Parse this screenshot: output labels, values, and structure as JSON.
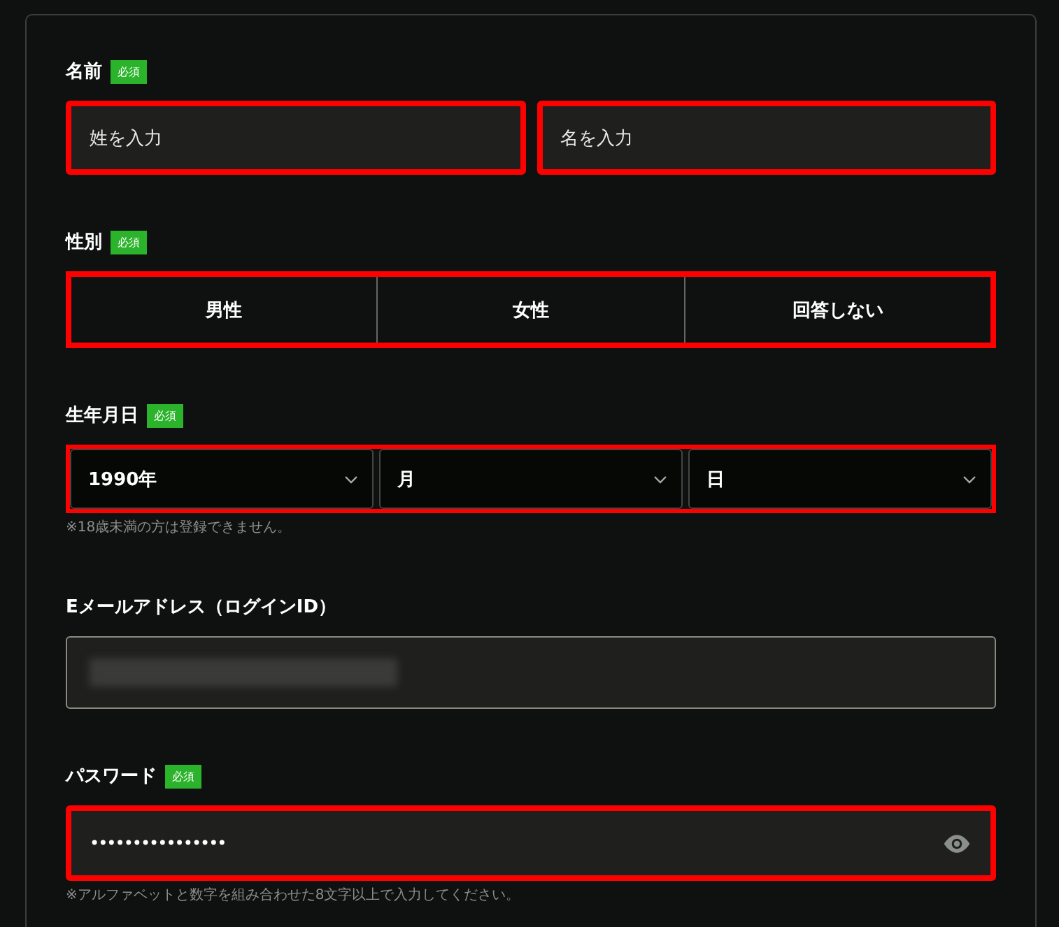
{
  "name": {
    "label": "名前",
    "badge": "必須",
    "fields": [
      {
        "placeholder": "姓を入力",
        "error": true
      },
      {
        "placeholder": "名を入力",
        "error": true
      }
    ]
  },
  "gender": {
    "label": "性別",
    "badge": "必須",
    "error": true,
    "options": [
      {
        "label": "男性",
        "selected": false
      },
      {
        "label": "女性",
        "selected": false
      },
      {
        "label": "回答しない",
        "selected": false
      }
    ]
  },
  "birthdate": {
    "label": "生年月日",
    "badge": "必須",
    "error": true,
    "selects": [
      {
        "value": "1990年"
      },
      {
        "value": "月"
      },
      {
        "value": "日"
      }
    ],
    "note": "※18歳未満の方は登録できません。"
  },
  "email": {
    "label": "Eメールアドレス（ログインID）",
    "error": false,
    "redacted": true
  },
  "password": {
    "label": "パスワード",
    "badge": "必須",
    "error": true,
    "value": "••••••••••••••••",
    "note": "※アルファベットと数字を組み合わせた8文字以上で入力してください。"
  }
}
